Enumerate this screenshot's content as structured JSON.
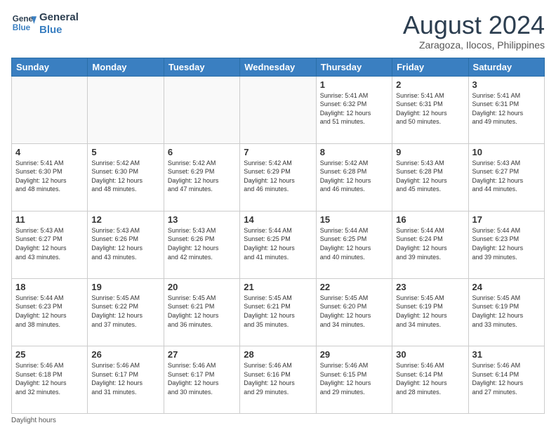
{
  "logo": {
    "line1": "General",
    "line2": "Blue"
  },
  "title": "August 2024",
  "location": "Zaragoza, Ilocos, Philippines",
  "days_of_week": [
    "Sunday",
    "Monday",
    "Tuesday",
    "Wednesday",
    "Thursday",
    "Friday",
    "Saturday"
  ],
  "footer": "Daylight hours",
  "weeks": [
    [
      {
        "day": "",
        "info": ""
      },
      {
        "day": "",
        "info": ""
      },
      {
        "day": "",
        "info": ""
      },
      {
        "day": "",
        "info": ""
      },
      {
        "day": "1",
        "info": "Sunrise: 5:41 AM\nSunset: 6:32 PM\nDaylight: 12 hours\nand 51 minutes."
      },
      {
        "day": "2",
        "info": "Sunrise: 5:41 AM\nSunset: 6:31 PM\nDaylight: 12 hours\nand 50 minutes."
      },
      {
        "day": "3",
        "info": "Sunrise: 5:41 AM\nSunset: 6:31 PM\nDaylight: 12 hours\nand 49 minutes."
      }
    ],
    [
      {
        "day": "4",
        "info": "Sunrise: 5:41 AM\nSunset: 6:30 PM\nDaylight: 12 hours\nand 48 minutes."
      },
      {
        "day": "5",
        "info": "Sunrise: 5:42 AM\nSunset: 6:30 PM\nDaylight: 12 hours\nand 48 minutes."
      },
      {
        "day": "6",
        "info": "Sunrise: 5:42 AM\nSunset: 6:29 PM\nDaylight: 12 hours\nand 47 minutes."
      },
      {
        "day": "7",
        "info": "Sunrise: 5:42 AM\nSunset: 6:29 PM\nDaylight: 12 hours\nand 46 minutes."
      },
      {
        "day": "8",
        "info": "Sunrise: 5:42 AM\nSunset: 6:28 PM\nDaylight: 12 hours\nand 46 minutes."
      },
      {
        "day": "9",
        "info": "Sunrise: 5:43 AM\nSunset: 6:28 PM\nDaylight: 12 hours\nand 45 minutes."
      },
      {
        "day": "10",
        "info": "Sunrise: 5:43 AM\nSunset: 6:27 PM\nDaylight: 12 hours\nand 44 minutes."
      }
    ],
    [
      {
        "day": "11",
        "info": "Sunrise: 5:43 AM\nSunset: 6:27 PM\nDaylight: 12 hours\nand 43 minutes."
      },
      {
        "day": "12",
        "info": "Sunrise: 5:43 AM\nSunset: 6:26 PM\nDaylight: 12 hours\nand 43 minutes."
      },
      {
        "day": "13",
        "info": "Sunrise: 5:43 AM\nSunset: 6:26 PM\nDaylight: 12 hours\nand 42 minutes."
      },
      {
        "day": "14",
        "info": "Sunrise: 5:44 AM\nSunset: 6:25 PM\nDaylight: 12 hours\nand 41 minutes."
      },
      {
        "day": "15",
        "info": "Sunrise: 5:44 AM\nSunset: 6:25 PM\nDaylight: 12 hours\nand 40 minutes."
      },
      {
        "day": "16",
        "info": "Sunrise: 5:44 AM\nSunset: 6:24 PM\nDaylight: 12 hours\nand 39 minutes."
      },
      {
        "day": "17",
        "info": "Sunrise: 5:44 AM\nSunset: 6:23 PM\nDaylight: 12 hours\nand 39 minutes."
      }
    ],
    [
      {
        "day": "18",
        "info": "Sunrise: 5:44 AM\nSunset: 6:23 PM\nDaylight: 12 hours\nand 38 minutes."
      },
      {
        "day": "19",
        "info": "Sunrise: 5:45 AM\nSunset: 6:22 PM\nDaylight: 12 hours\nand 37 minutes."
      },
      {
        "day": "20",
        "info": "Sunrise: 5:45 AM\nSunset: 6:21 PM\nDaylight: 12 hours\nand 36 minutes."
      },
      {
        "day": "21",
        "info": "Sunrise: 5:45 AM\nSunset: 6:21 PM\nDaylight: 12 hours\nand 35 minutes."
      },
      {
        "day": "22",
        "info": "Sunrise: 5:45 AM\nSunset: 6:20 PM\nDaylight: 12 hours\nand 34 minutes."
      },
      {
        "day": "23",
        "info": "Sunrise: 5:45 AM\nSunset: 6:19 PM\nDaylight: 12 hours\nand 34 minutes."
      },
      {
        "day": "24",
        "info": "Sunrise: 5:45 AM\nSunset: 6:19 PM\nDaylight: 12 hours\nand 33 minutes."
      }
    ],
    [
      {
        "day": "25",
        "info": "Sunrise: 5:46 AM\nSunset: 6:18 PM\nDaylight: 12 hours\nand 32 minutes."
      },
      {
        "day": "26",
        "info": "Sunrise: 5:46 AM\nSunset: 6:17 PM\nDaylight: 12 hours\nand 31 minutes."
      },
      {
        "day": "27",
        "info": "Sunrise: 5:46 AM\nSunset: 6:17 PM\nDaylight: 12 hours\nand 30 minutes."
      },
      {
        "day": "28",
        "info": "Sunrise: 5:46 AM\nSunset: 6:16 PM\nDaylight: 12 hours\nand 29 minutes."
      },
      {
        "day": "29",
        "info": "Sunrise: 5:46 AM\nSunset: 6:15 PM\nDaylight: 12 hours\nand 29 minutes."
      },
      {
        "day": "30",
        "info": "Sunrise: 5:46 AM\nSunset: 6:14 PM\nDaylight: 12 hours\nand 28 minutes."
      },
      {
        "day": "31",
        "info": "Sunrise: 5:46 AM\nSunset: 6:14 PM\nDaylight: 12 hours\nand 27 minutes."
      }
    ]
  ]
}
